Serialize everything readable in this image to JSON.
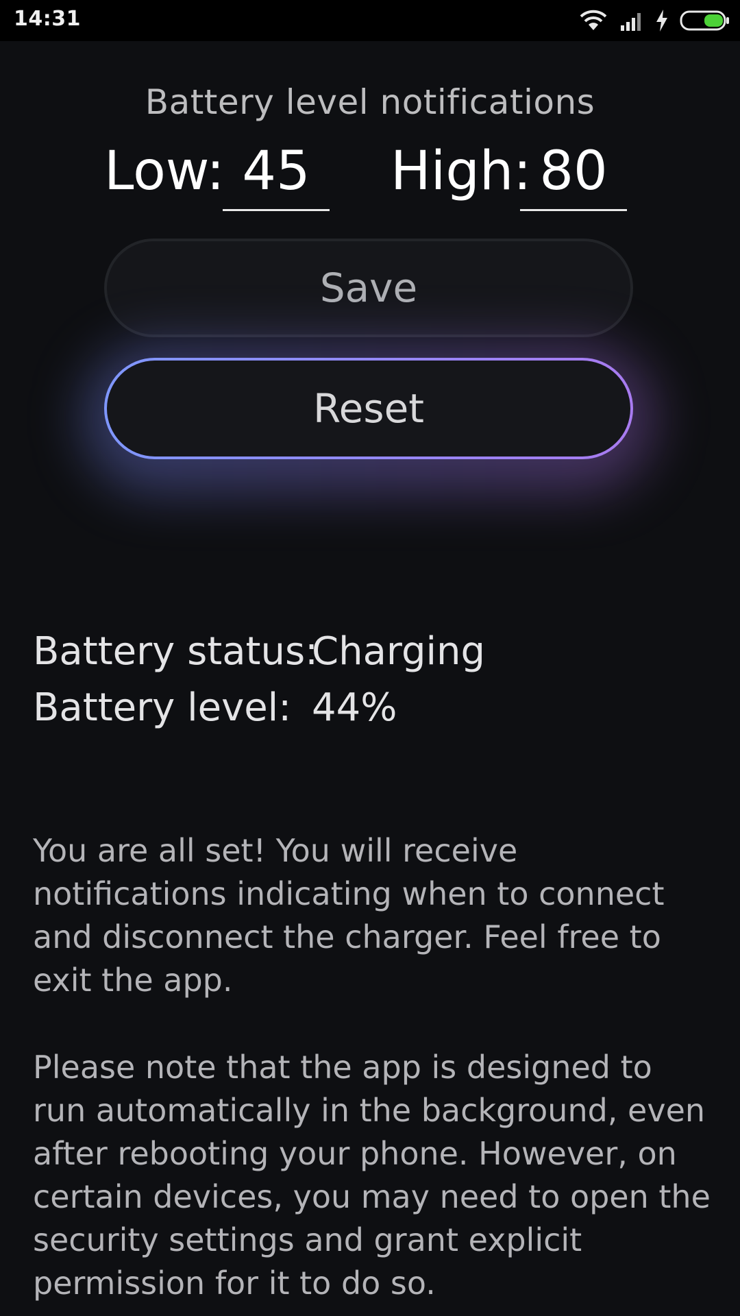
{
  "status_bar": {
    "time": "14:31",
    "icons": [
      "wifi-icon",
      "signal-icon",
      "charging-bolt-icon",
      "battery-icon"
    ],
    "battery_fill_color": "#4cd137"
  },
  "notifications": {
    "title": "Battery level notifications",
    "low_label": "Low:",
    "low_value": "45",
    "high_label": "High:",
    "high_value": "80"
  },
  "buttons": {
    "save_label": "Save",
    "reset_label": "Reset"
  },
  "colors": {
    "reset_gradient_start": "#7f97ff",
    "reset_gradient_end": "#a87bf0"
  },
  "battery_info": {
    "status_label": "Battery status:",
    "status_value": "Charging",
    "level_label": "Battery level:",
    "level_value": "44%"
  },
  "messages": {
    "paragraph_1": "You are all set! You will receive notifications indicating when to connect and disconnect the charger. Feel free to exit the app.",
    "paragraph_2": "Please note that the app is designed to run automatically in the background, even after rebooting your phone. However, on certain devices, you may need to open the security settings and grant explicit permission for it to do so."
  }
}
